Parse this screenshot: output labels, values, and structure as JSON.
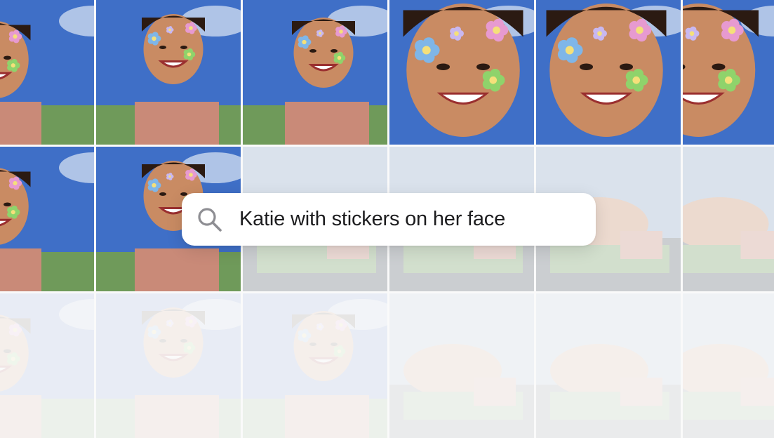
{
  "search": {
    "query": "Katie with stickers on her face",
    "icon": "magnifying-glass-icon"
  },
  "photos": {
    "subject": "photo-thumbnail",
    "rows": [
      {
        "state": "visible",
        "count": 6
      },
      {
        "state": "partially-faded",
        "count": 6
      },
      {
        "state": "faded",
        "count": 6
      }
    ]
  },
  "colors": {
    "pill_background": "#ffffff",
    "text": "#1c1c1e",
    "sky": "#3f6fc7",
    "sweater": "#6f9a5a",
    "overalls": "#c98a78",
    "skin": "#c98b63"
  }
}
